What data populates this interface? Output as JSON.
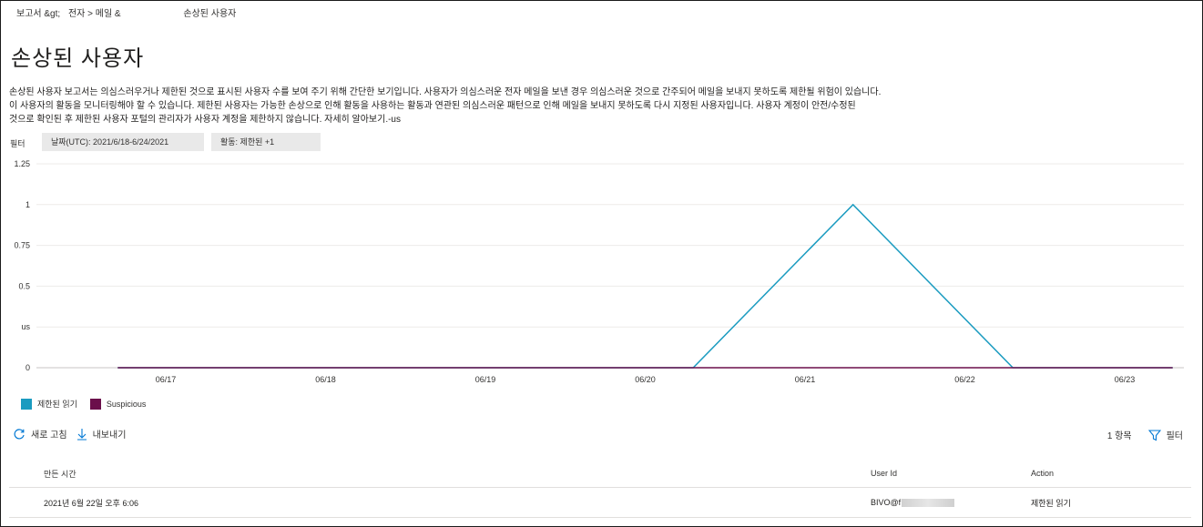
{
  "breadcrumb": [
    "보고서 &gt;",
    "전자 > 메일 &",
    "손상된 사용자"
  ],
  "page_title": "손상된 사용자",
  "description": [
    "손상된 사용자 보고서는 의심스러우거나 제한된 것으로 표시된 사용자 수를 보여 주기 위해 간단한 보기입니다. 사용자가 의심스러운 전자 메일을 보낸 경우 의심스러운 것으로 간주되어 메일을 보내지 못하도록 제한될 위험이 있습니다.",
    "이 사용자의 활동을 모니터링해야 할 수 있습니다. 제한된 사용자는 가능한 손상으로 인해 활동을 사용하는 활동과 연관된 의심스러운 패턴으로 인해 메일을 보내지 못하도록 다시 지정된 사용자입니다. 사용자 계정이 안전/수정된",
    "것으로 확인된 후 제한된 사용자 포털의 관리자가 사용자 계정을 제한하지 않습니다. 자세히 알아보기.-us"
  ],
  "filters": {
    "label": "필터",
    "date": "날짜(UTC): 2021/6/18-6/24/2021",
    "activity": "활동: 제한된 +1"
  },
  "chart_data": {
    "type": "line",
    "x": [
      "06/17",
      "06/18",
      "06/19",
      "06/20",
      "06/21",
      "06/22",
      "06/23"
    ],
    "ylim": [
      0,
      1.25
    ],
    "yticks": [
      "1.25",
      "1",
      "0.75",
      "0.5",
      "us",
      "0"
    ],
    "ylabel": "",
    "series": [
      {
        "name": "제한된 읽기",
        "color": "#1a9bc0",
        "points": [
          [
            "06/16.7",
            0
          ],
          [
            "06/20.3",
            0
          ],
          [
            "06/21.3",
            1
          ],
          [
            "06/22.3",
            0
          ],
          [
            "06/23.3",
            0
          ]
        ]
      },
      {
        "name": "Suspicious",
        "color": "#6b0f4b",
        "points": [
          [
            "06/16.7",
            0
          ],
          [
            "06/23.3",
            0
          ]
        ]
      }
    ],
    "grid": true,
    "legend_position": "bottom-left"
  },
  "legend": [
    {
      "label": "제한된 읽기",
      "color": "#1a9bc0"
    },
    {
      "label": "Suspicious",
      "color": "#6b0f4b"
    }
  ],
  "toolbar": {
    "refresh": "새로 고침",
    "export": "내보내기",
    "item_count": "1 항목",
    "filter": "필터"
  },
  "table": {
    "headers": [
      "만든 시간",
      "User Id",
      "Action"
    ],
    "rows": [
      {
        "created": "2021년 6월 22일 오후 6:06",
        "user": "BIVO@f",
        "action": "제한된 읽기"
      }
    ]
  }
}
